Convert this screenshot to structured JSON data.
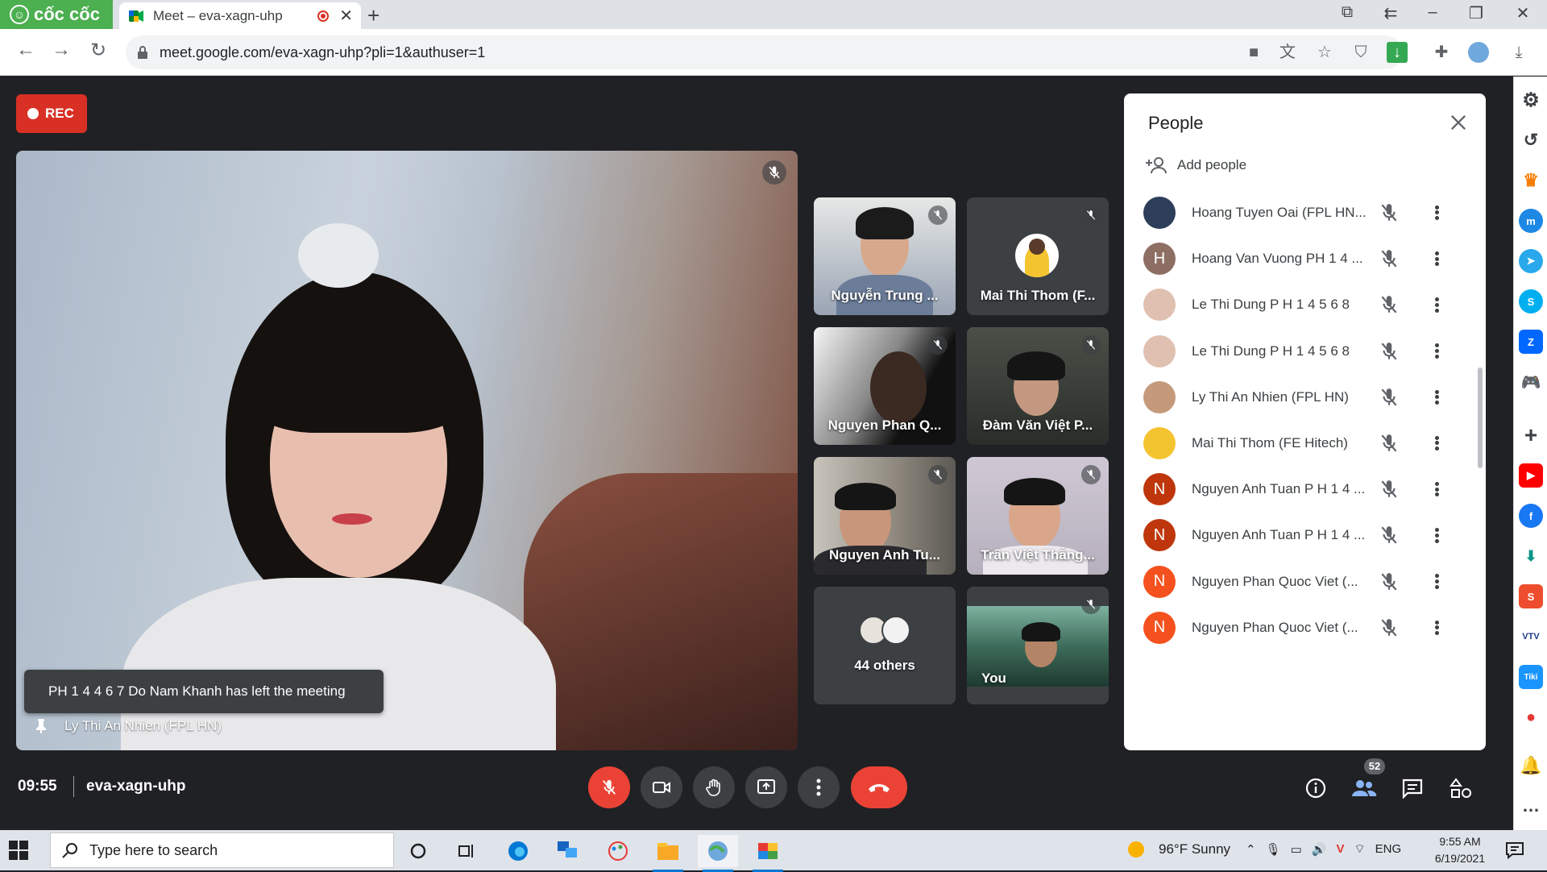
{
  "browser": {
    "brand": "cốc cốc",
    "tab_title": "Meet – eva-xagn-uhp",
    "url": "meet.google.com/eva-xagn-uhp?pli=1&authuser=1"
  },
  "meet": {
    "rec_label": "REC",
    "main_speaker_name": "Ly Thi An Nhien (FPL HN)",
    "toast": "PH 1 4 4 6 7 Do Nam Khanh has left the meeting",
    "tiles": [
      {
        "name": "Nguyễn Trung ..."
      },
      {
        "name": "Mai Thi Thom (F..."
      },
      {
        "name": "Nguyen Phan Q..."
      },
      {
        "name": "Đàm Văn Việt P..."
      },
      {
        "name": "Nguyen Anh Tu..."
      },
      {
        "name": "Trần Việt Thắng..."
      },
      {
        "name": "44 others"
      },
      {
        "name": "You"
      }
    ],
    "time": "09:55",
    "meeting_code": "eva-xagn-uhp",
    "participant_count": "52"
  },
  "people_panel": {
    "title": "People",
    "add_people": "Add people",
    "participants": [
      {
        "name": "Hoang Tuyen Oai (FPL HN...",
        "initial": "",
        "color": "#2d3e5a"
      },
      {
        "name": "Hoang Van Vuong PH 1 4 ...",
        "initial": "H",
        "color": "#8d6e63"
      },
      {
        "name": "Le Thi Dung P H 1 4 5 6 8",
        "initial": "",
        "color": "#e0c0b0"
      },
      {
        "name": "Le Thi Dung P H 1 4 5 6 8",
        "initial": "",
        "color": "#e0c0b0"
      },
      {
        "name": "Ly Thi An Nhien (FPL HN)",
        "initial": "",
        "color": "#c49a7a"
      },
      {
        "name": "Mai Thi Thom (FE Hitech)",
        "initial": "",
        "color": "#f4c430"
      },
      {
        "name": "Nguyen Anh Tuan P H 1 4 ...",
        "initial": "N",
        "color": "#bf360c"
      },
      {
        "name": "Nguyen Anh Tuan P H 1 4 ...",
        "initial": "N",
        "color": "#bf360c"
      },
      {
        "name": "Nguyen Phan Quoc Viet (...",
        "initial": "N",
        "color": "#f4511e"
      },
      {
        "name": "Nguyen Phan Quoc Viet (...",
        "initial": "N",
        "color": "#f4511e"
      }
    ]
  },
  "taskbar": {
    "search_placeholder": "Type here to search",
    "weather": "96°F  Sunny",
    "language": "ENG",
    "time": "9:55 AM",
    "date": "6/19/2021"
  }
}
